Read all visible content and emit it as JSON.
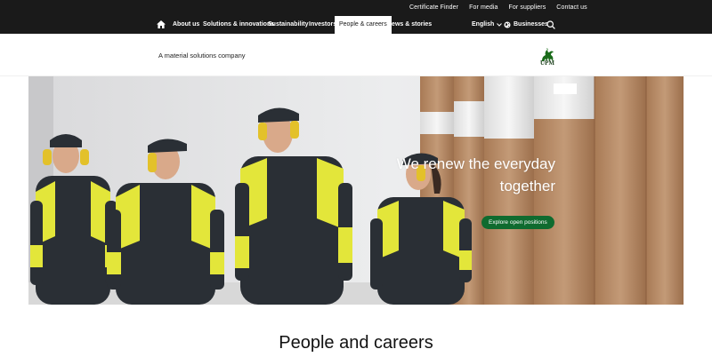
{
  "utility_nav": [
    "Certificate Finder",
    "For media",
    "For suppliers",
    "Contact us"
  ],
  "main_nav": {
    "home_icon": "home-icon",
    "items": [
      "About us",
      "Sustainability",
      "Investors",
      "People & careers",
      "News & stories"
    ],
    "solutions": "Solutions & innovations",
    "active": "People & careers",
    "language": "English",
    "businesses": "Businesses"
  },
  "header": {
    "tagline": "A material solutions company",
    "logo_text": "UPM"
  },
  "hero": {
    "title_line1": "We renew the everyday",
    "title_line2": "together",
    "button": "Explore open positions"
  },
  "section": {
    "title": "People and careers"
  },
  "colors": {
    "nav_bg": "#1a1a1a",
    "accent": "#0f6b2f",
    "logo": "#1a6b1a",
    "vest": "#e3e63a"
  }
}
